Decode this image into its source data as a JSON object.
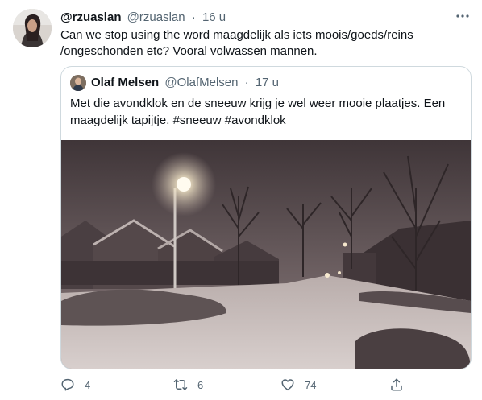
{
  "tweet": {
    "display_name": "@rzuaslan",
    "handle": "@rzuaslan",
    "separator": "·",
    "time": "16 u",
    "text": "Can we stop using the word maagdelijk als iets moois/goeds/reins /ongeschonden etc? Vooral volwassen mannen."
  },
  "quote": {
    "display_name": "Olaf Melsen",
    "handle": "@OlafMelsen",
    "separator": "·",
    "time": "17 u",
    "text": "Met die avondklok en de sneeuw krijg je wel weer mooie plaatjes. Een maagdelijk tapijtje. #sneeuw #avondklok"
  },
  "actions": {
    "reply_count": "4",
    "retweet_count": "6",
    "like_count": "74"
  },
  "icons": {
    "more": "more-icon",
    "reply": "reply-icon",
    "retweet": "retweet-icon",
    "like": "like-icon",
    "share": "share-icon"
  },
  "colors": {
    "text": "#0f1419",
    "secondary": "#536471",
    "border": "#cfd9de"
  }
}
